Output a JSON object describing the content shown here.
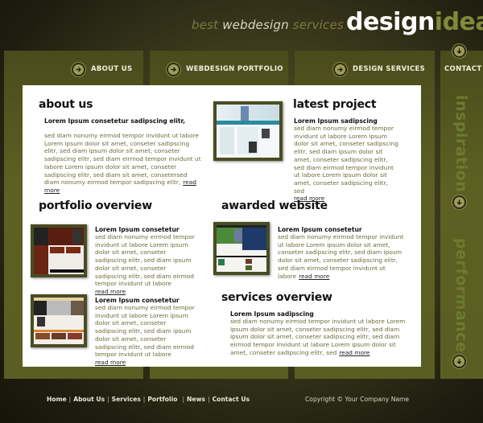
{
  "header": {
    "tagline_pre": "best ",
    "tagline_highlight": "webdesign",
    "tagline_post": " services",
    "logo_part1": "design",
    "logo_part2": "idea"
  },
  "nav": [
    {
      "label": "ABOUT US",
      "icon": "arrow-right-circle-icon"
    },
    {
      "label": "WEBDESIGN PORTFOLIO",
      "icon": "arrow-right-circle-icon"
    },
    {
      "label": "DESIGN SERVICES",
      "icon": "arrow-right-circle-icon"
    },
    {
      "label": "CONTACT",
      "icon": "arrow-down-circle-icon"
    }
  ],
  "side": {
    "item1": "inspiration",
    "item2": "performance"
  },
  "sections": {
    "about": {
      "title": "about us",
      "subtitle": "Lorem Ipsum consetetur sadipscing elitr,",
      "body": "sed diam nonumy eirmod tempor invidunt ut labore Lorem ipsum dolor sit amet, conseter sadipscing elitr, sed diam ipsum dolor sit amet, conseter sadipscing elitr, sed diam eirmod tempor invidunt ut labore Lorem ipsum dolor sit amet, conseter sadipscing elitr, sed diam sit amet, consetersed diam nonumy eirmod tempor sadipscing elitr,",
      "more": "read more"
    },
    "latest": {
      "title": "latest project",
      "subtitle": "Lorem Ipsum sadipscing",
      "body": "sed diam nonumy eirmod tempor invidunt ut labore Lorem ipsum dolor sit amet, conseter sadipscing elitr, sed diam ipsum dolor sit amet, conseter sadipscing elitr, sed diam eirmod tempor invidunt ut labore Lorem ipsum dolor sit amet, conseter sadipscing elitr, sed",
      "more": "read more"
    },
    "portfolio": {
      "title": "portfolio overview",
      "items": [
        {
          "subtitle": "Lorem Ipsum consetetur",
          "body": "sed diam nonumy eirmod tempor invidunt ut labore Lorem ipsum dolor sit amet, conseter sadipscing elitr, sed diam ipsum dolor sit amet, conseter sadipscing elitr, sed diam eirmod tempor invidunt ut labore",
          "more": "read more"
        },
        {
          "subtitle": "Lorem Ipsum consetetur",
          "body": "sed diam nonumy eirmod tempor invidunt ut labore Lorem ipsum dolor sit amet, conseter sadipscing elitr, sed diam ipsum dolor sit amet, conseter sadipscing elitr, sed diam eirmod tempor invidunt ut labore",
          "more": "read more"
        }
      ]
    },
    "awarded": {
      "title": "awarded website",
      "subtitle": "Lorem Ipsum consetetur",
      "body": "sed diam nonumy eirmod tempor invidunt ut labore Lorem ipsum dolor sit amet, conseter sadipscing elitr, sed diam ipsum dolor sit amet, conseter sadipscing elitr, sed diam eirmod tempor invidunt ut labore",
      "more": "read more"
    },
    "services": {
      "title": "services overview",
      "subtitle": "Lorem Ipsum sadipscing",
      "body": "sed diam nonumy eirmod tempor invidunt ut labore Lorem ipsum dolor sit amet, conseter sadipscing elitr, sed diam ipsum dolor sit amet, conseter sadipscing elitr, sed diam eirmod tempor invidunt ut labore Lorem ipsum dolor sit amet, conseter sadipscing elitr, sed",
      "more": "read more"
    }
  },
  "footer": {
    "links": [
      "Home",
      "About Us",
      "Services",
      "Portfolio",
      "News",
      "Contact Us"
    ],
    "copyright": "Copyright © Your Company Name"
  }
}
